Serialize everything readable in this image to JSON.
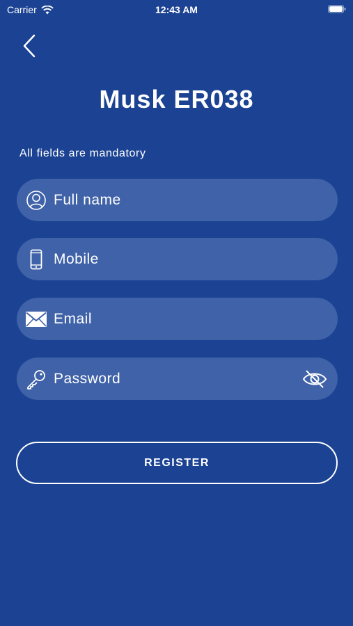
{
  "status_bar": {
    "carrier": "Carrier",
    "time": "12:43 AM"
  },
  "header": {
    "title": "Musk ER038",
    "back_icon": "chevron-left-icon"
  },
  "form": {
    "note": "All fields are mandatory",
    "fields": [
      {
        "placeholder": "Full name",
        "icon": "user-icon"
      },
      {
        "placeholder": "Mobile",
        "icon": "phone-icon"
      },
      {
        "placeholder": "Email",
        "icon": "mail-icon"
      },
      {
        "placeholder": "Password",
        "icon": "key-icon",
        "toggle_icon": "eye-off-icon"
      }
    ],
    "register_label": "REGISTER"
  },
  "colors": {
    "background": "#1c4393",
    "field": "#3f62a8",
    "text": "#ffffff"
  }
}
